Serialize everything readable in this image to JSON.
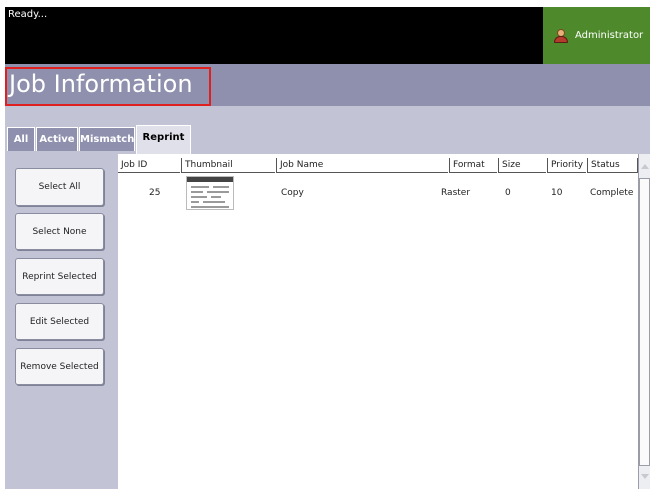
{
  "status_text": "Ready...",
  "user": {
    "name": "Administrator",
    "icon": "admin-user-icon"
  },
  "title": "Job Information",
  "tabs": [
    {
      "label": "All",
      "active": false
    },
    {
      "label": "Active",
      "active": false
    },
    {
      "label": "Mismatch",
      "active": false
    },
    {
      "label": "Reprint",
      "active": true
    }
  ],
  "actions": {
    "select_all": "Select All",
    "select_none": "Select None",
    "reprint_selected": "Reprint Selected",
    "edit_selected": "Edit Selected",
    "remove_selected": "Remove Selected"
  },
  "table": {
    "columns": [
      "Job ID",
      "Thumbnail",
      "Job Name",
      "Format",
      "Size",
      "Priority",
      "Status"
    ],
    "rows": [
      {
        "job_id": "25",
        "thumbnail": "document-thumbnail",
        "job_name": "Copy",
        "format": "Raster",
        "size": "0",
        "priority": "10",
        "status": "Complete"
      }
    ]
  },
  "colors": {
    "header_bg": "#000000",
    "admin_bg": "#4e8a2c",
    "title_bg": "#8e90ae",
    "panel_bg": "#c2c4d6",
    "highlight": "#e02020"
  }
}
